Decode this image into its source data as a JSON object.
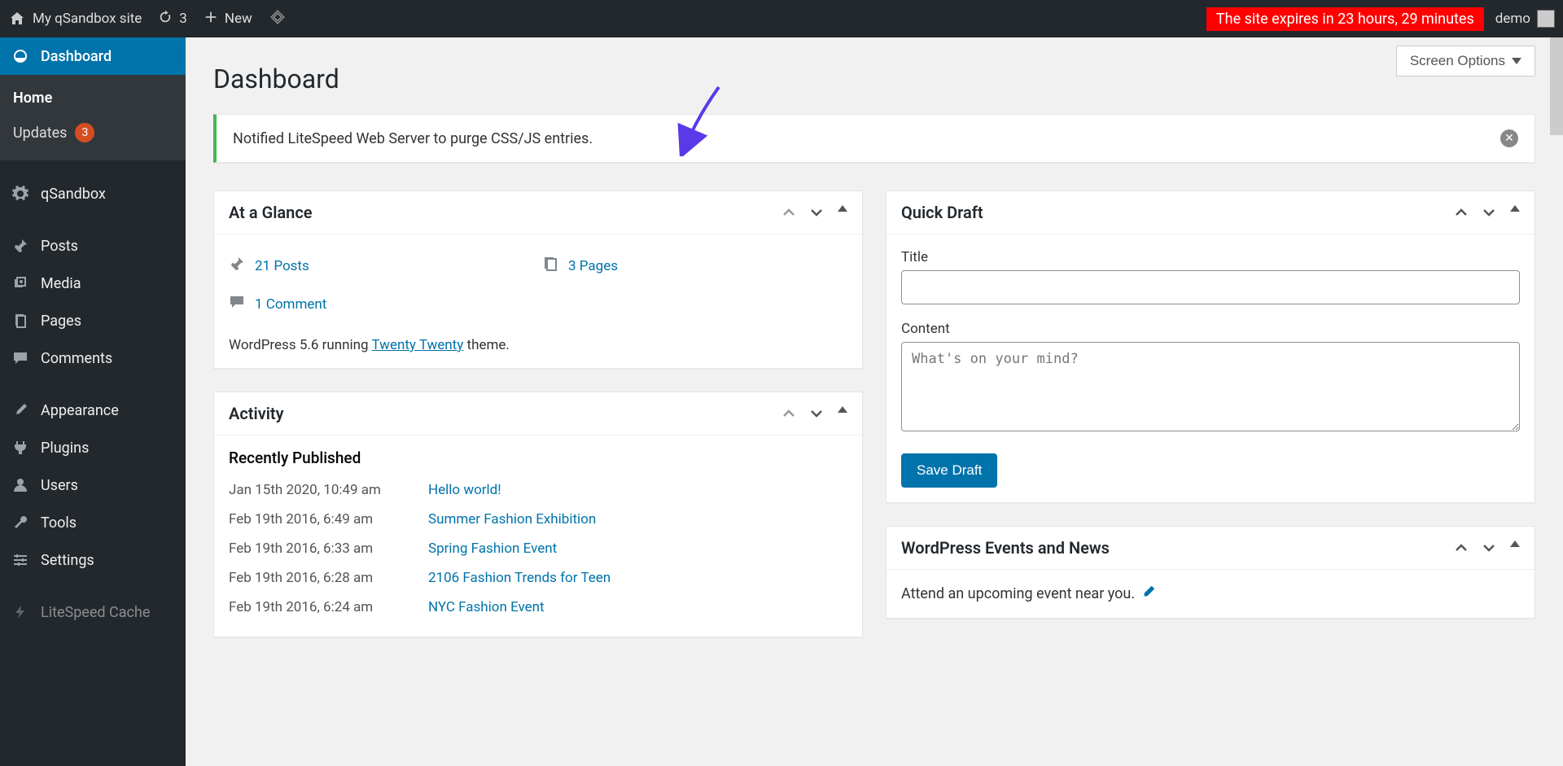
{
  "adminBar": {
    "siteName": "My qSandbox site",
    "updateCount": "3",
    "newLabel": "New",
    "expireNotice": "The site expires in  23 hours, 29 minutes",
    "userName": "demo"
  },
  "sidebar": {
    "items": [
      {
        "label": "Dashboard",
        "icon": "dashboard"
      },
      {
        "label": "qSandbox",
        "icon": "gear"
      },
      {
        "label": "Posts",
        "icon": "pin"
      },
      {
        "label": "Media",
        "icon": "media"
      },
      {
        "label": "Pages",
        "icon": "page"
      },
      {
        "label": "Comments",
        "icon": "comment"
      },
      {
        "label": "Appearance",
        "icon": "brush"
      },
      {
        "label": "Plugins",
        "icon": "plug"
      },
      {
        "label": "Users",
        "icon": "user"
      },
      {
        "label": "Tools",
        "icon": "wrench"
      },
      {
        "label": "Settings",
        "icon": "sliders"
      },
      {
        "label": "LiteSpeed Cache",
        "icon": "bolt"
      }
    ],
    "submenu": {
      "home": "Home",
      "updates": "Updates",
      "updatesCount": "3"
    }
  },
  "screenOptions": "Screen Options",
  "pageTitle": "Dashboard",
  "notice": "Notified LiteSpeed Web Server to purge CSS/JS entries.",
  "glance": {
    "title": "At a Glance",
    "posts": "21 Posts",
    "pages": "3 Pages",
    "comments": "1 Comment",
    "versionPrefix": "WordPress 5.6 running ",
    "theme": "Twenty Twenty",
    "versionSuffix": " theme."
  },
  "activity": {
    "title": "Activity",
    "subTitle": "Recently Published",
    "rows": [
      {
        "date": "Jan 15th 2020, 10:49 am",
        "title": "Hello world!"
      },
      {
        "date": "Feb 19th 2016, 6:49 am",
        "title": "Summer Fashion Exhibition"
      },
      {
        "date": "Feb 19th 2016, 6:33 am",
        "title": "Spring Fashion Event"
      },
      {
        "date": "Feb 19th 2016, 6:28 am",
        "title": "2106 Fashion Trends for Teen"
      },
      {
        "date": "Feb 19th 2016, 6:24 am",
        "title": "NYC Fashion Event"
      }
    ]
  },
  "quickDraft": {
    "title": "Quick Draft",
    "titleLabel": "Title",
    "contentLabel": "Content",
    "contentPlaceholder": "What's on your mind?",
    "saveLabel": "Save Draft"
  },
  "events": {
    "title": "WordPress Events and News",
    "text": "Attend an upcoming event near you."
  }
}
